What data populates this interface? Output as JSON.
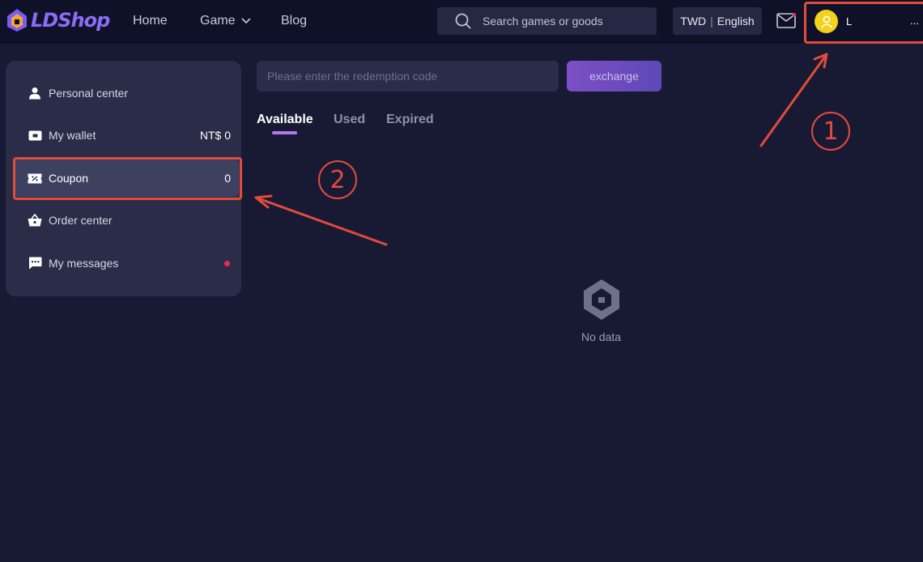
{
  "header": {
    "logo_text": "LDShop",
    "nav": {
      "home": "Home",
      "game": "Game",
      "blog": "Blog"
    },
    "search_placeholder": "Search games or goods",
    "currency": "TWD",
    "language": "English",
    "username": "L",
    "more": "..."
  },
  "sidebar": {
    "items": [
      {
        "label": "Personal center",
        "icon": "person-icon"
      },
      {
        "label": "My wallet",
        "value": "NT$ 0",
        "icon": "wallet-icon"
      },
      {
        "label": "Coupon",
        "value": "0",
        "icon": "ticket-icon"
      },
      {
        "label": "Order center",
        "icon": "basket-icon"
      },
      {
        "label": "My messages",
        "icon": "chat-icon"
      }
    ]
  },
  "main": {
    "code_placeholder": "Please enter the redemption code",
    "exchange_label": "exchange",
    "tabs": [
      "Available",
      "Used",
      "Expired"
    ],
    "empty_text": "No data"
  },
  "annotations": {
    "step1": "1",
    "step2": "2"
  },
  "colors": {
    "accent": "#b178f5",
    "annotation": "#e24b3c",
    "background": "#181a33"
  }
}
